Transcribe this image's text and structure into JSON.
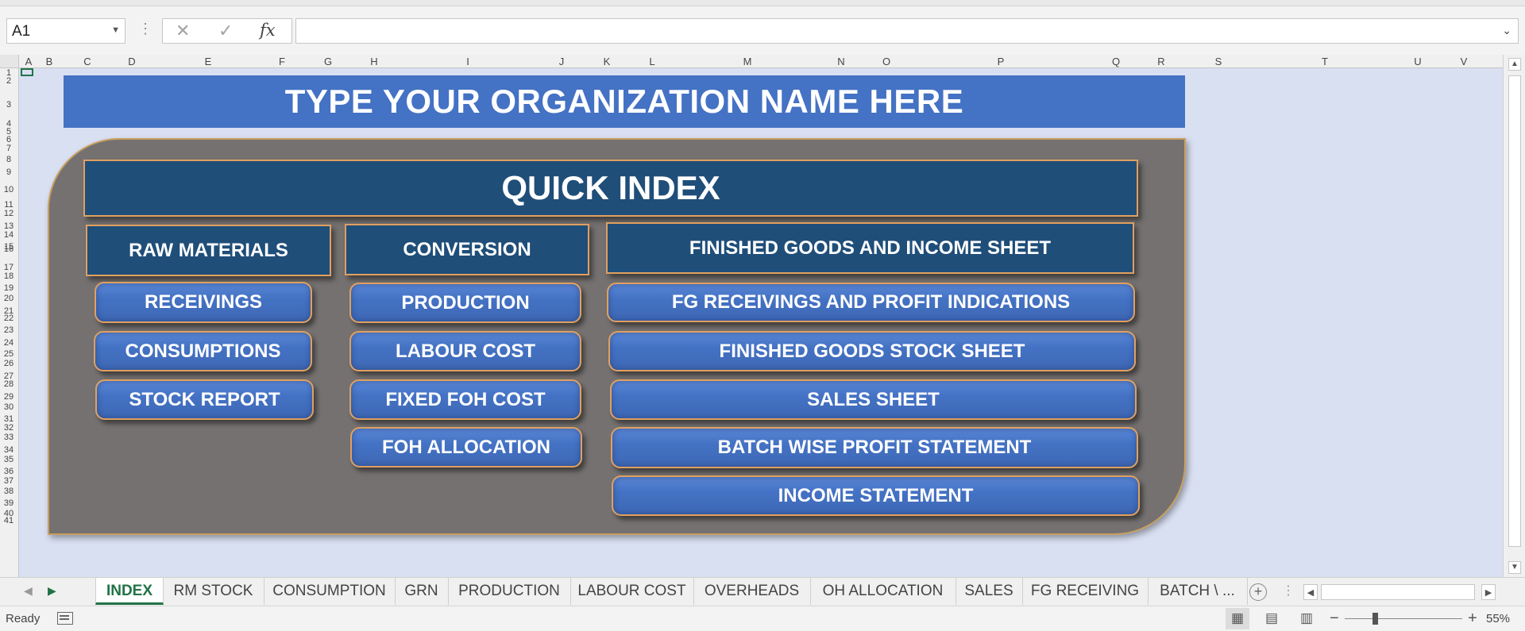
{
  "formula_bar": {
    "name_box_value": "A1",
    "cancel_icon": "close-icon",
    "enter_icon": "check-icon",
    "function_label": "fx",
    "formula_value": ""
  },
  "columns": [
    "A",
    "B",
    "C",
    "D",
    "E",
    "F",
    "G",
    "H",
    "I",
    "J",
    "K",
    "L",
    "M",
    "N",
    "O",
    "P",
    "Q",
    "R",
    "S",
    "T",
    "U",
    "V"
  ],
  "rows": [
    "1",
    "2",
    "3",
    "4",
    "5",
    "6",
    "7",
    "8",
    "9",
    "10",
    "11",
    "12",
    "13",
    "14",
    "15",
    "16",
    "17",
    "18",
    "19",
    "20",
    "21",
    "22",
    "23",
    "24",
    "25",
    "26",
    "27",
    "28",
    "29",
    "30",
    "31",
    "32",
    "33",
    "34",
    "35",
    "36",
    "37",
    "38",
    "39",
    "40",
    "41"
  ],
  "sheet": {
    "org_title": "TYPE YOUR ORGANIZATION NAME HERE",
    "quick_index": "QUICK INDEX",
    "raw_materials": {
      "header": "RAW MATERIALS",
      "buttons": [
        "RECEIVINGS",
        "CONSUMPTIONS",
        "STOCK REPORT"
      ]
    },
    "conversion": {
      "header": "CONVERSION",
      "buttons": [
        "PRODUCTION",
        "LABOUR COST",
        "FIXED FOH COST",
        "FOH ALLOCATION"
      ]
    },
    "finished_goods": {
      "header": "FINISHED GOODS AND INCOME SHEET",
      "buttons": [
        "FG RECEIVINGS AND PROFIT INDICATIONS",
        "FINISHED GOODS STOCK SHEET",
        "SALES SHEET",
        "BATCH WISE PROFIT STATEMENT",
        "INCOME STATEMENT"
      ]
    }
  },
  "tabs": [
    "INDEX",
    "RM STOCK",
    "CONSUMPTION",
    "GRN",
    "PRODUCTION",
    "LABOUR COST",
    "OVERHEADS",
    "OH ALLOCATION",
    "SALES",
    "FG RECEIVING",
    "BATCH \\ ..."
  ],
  "active_tab": "INDEX",
  "add_sheet_label": "+",
  "status": {
    "text": "Ready",
    "zoom_minus": "−",
    "zoom_plus": "+",
    "zoom_level": "55%"
  },
  "colors": {
    "accent": "#217346",
    "title_blue": "#4472c4",
    "dark_blue": "#1f4e79",
    "panel_gray": "#757171",
    "border_orange": "#e0a060",
    "sheet_background": "#d9e0f2"
  }
}
